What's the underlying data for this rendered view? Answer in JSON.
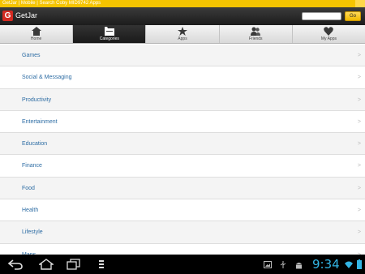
{
  "browser": {
    "title": "GetJar | Mobile | Search Coby MID9742 Apps"
  },
  "header": {
    "logo_letter": "G",
    "logo_text": "GetJar",
    "search_placeholder": "",
    "go_label": "Go"
  },
  "tabs": [
    {
      "label": "Home",
      "icon": "home-icon",
      "active": false
    },
    {
      "label": "Categories",
      "icon": "categories-icon",
      "active": true
    },
    {
      "label": "Apps",
      "icon": "star-icon",
      "active": false
    },
    {
      "label": "Friends",
      "icon": "friends-icon",
      "active": false
    },
    {
      "label": "My Apps",
      "icon": "heart-icon",
      "active": false
    }
  ],
  "categories": [
    {
      "label": "Games",
      "chevron": ">"
    },
    {
      "label": "Social & Messaging",
      "chevron": ">"
    },
    {
      "label": "Productivity",
      "chevron": ">"
    },
    {
      "label": "Entertainment",
      "chevron": ">"
    },
    {
      "label": "Education",
      "chevron": ">"
    },
    {
      "label": "Finance",
      "chevron": ">"
    },
    {
      "label": "Food",
      "chevron": ">"
    },
    {
      "label": "Health",
      "chevron": ">"
    },
    {
      "label": "Lifestyle",
      "chevron": ">"
    },
    {
      "label": "Maps",
      "chevron": ">"
    }
  ],
  "system_bar": {
    "time": "9:34",
    "clock_color": "#33b5e5",
    "nav_icons": [
      "back-icon",
      "home-icon",
      "recent-apps-icon",
      "menu-icon"
    ],
    "status_icons": [
      "screenshot-icon",
      "usb-icon",
      "android-debug-icon",
      "wifi-icon",
      "battery-icon"
    ]
  },
  "colors": {
    "title_bar": "#f5c400",
    "link": "#2e6da4",
    "logo": "#d42b22"
  }
}
